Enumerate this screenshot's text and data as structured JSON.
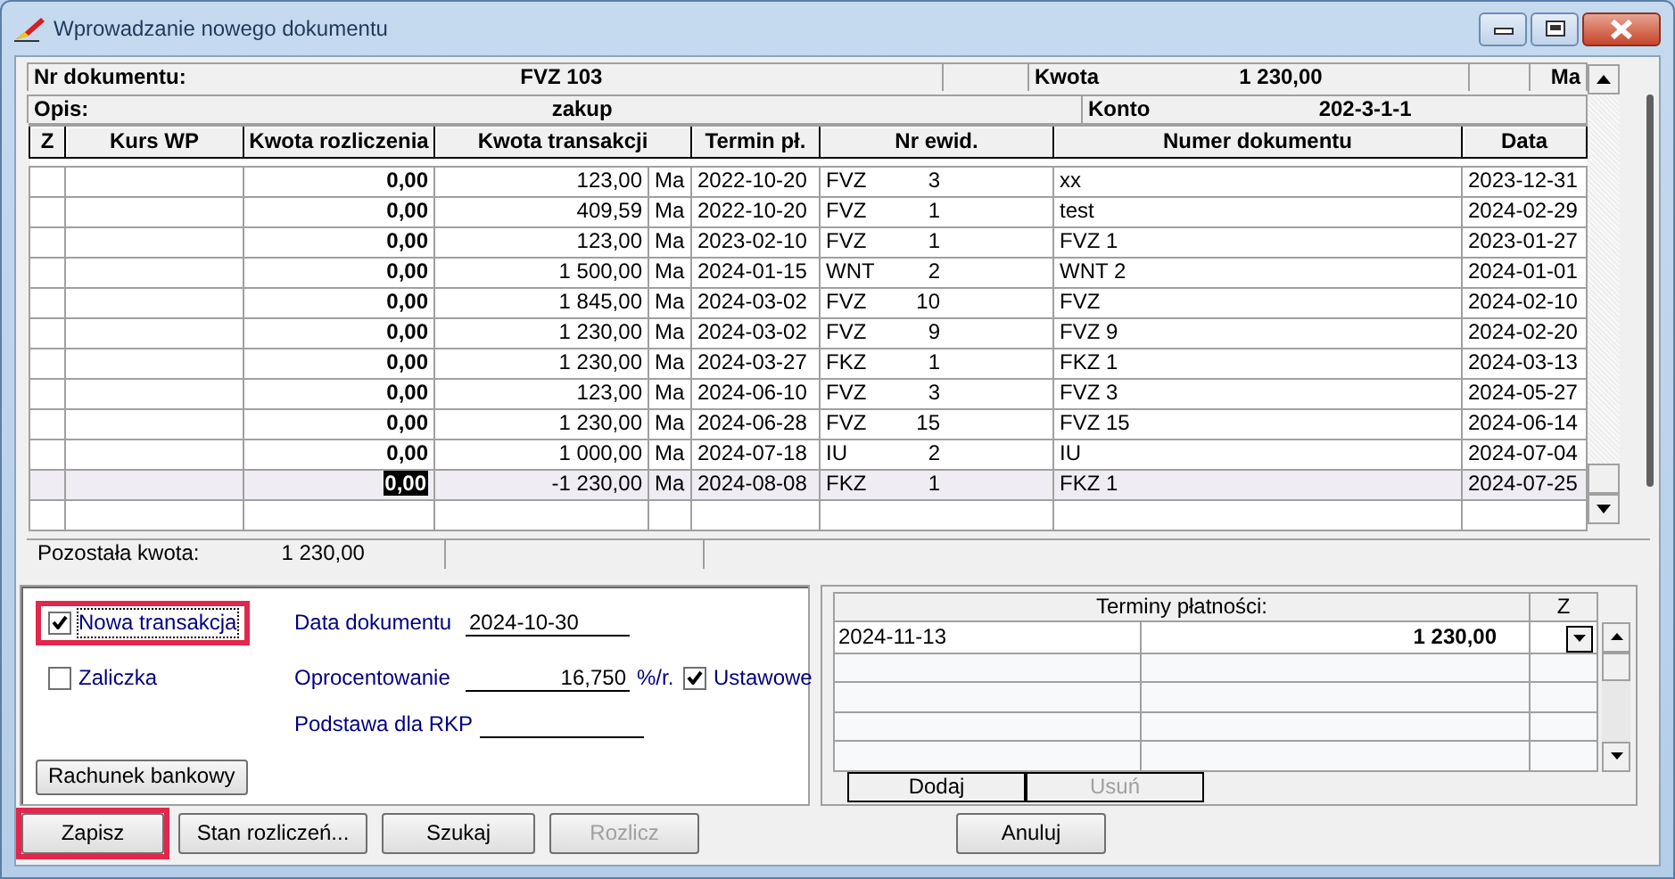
{
  "window": {
    "title": "Wprowadzanie nowego dokumentu"
  },
  "document_header": {
    "nr_label": "Nr dokumentu:",
    "nr_value": "FVZ 103",
    "kwota_label": "Kwota",
    "kwota_value": "1 230,00",
    "currency": "Ma",
    "opis_label": "Opis:",
    "opis_value": "zakup",
    "konto_label": "Konto",
    "konto_value": "202-3-1-1"
  },
  "table": {
    "columns": [
      "Z",
      "Kurs WP",
      "Kwota rozliczenia",
      "Kwota transakcji",
      "Termin pł.",
      "Nr ewid.",
      "Numer dokumentu",
      "Data"
    ],
    "rows": [
      {
        "kwota_rozliczenia": "0,00",
        "kwota_transakcji": "123,00",
        "side": "Ma",
        "termin": "2022-10-20",
        "nr_ewid_type": "FVZ",
        "nr_ewid_number": "3",
        "numer_dokumentu": "xx",
        "data": "2023-12-31",
        "selected": false
      },
      {
        "kwota_rozliczenia": "0,00",
        "kwota_transakcji": "409,59",
        "side": "Ma",
        "termin": "2022-10-20",
        "nr_ewid_type": "FVZ",
        "nr_ewid_number": "1",
        "numer_dokumentu": "test",
        "data": "2024-02-29",
        "selected": false
      },
      {
        "kwota_rozliczenia": "0,00",
        "kwota_transakcji": "123,00",
        "side": "Ma",
        "termin": "2023-02-10",
        "nr_ewid_type": "FVZ",
        "nr_ewid_number": "1",
        "numer_dokumentu": "FVZ 1",
        "data": "2023-01-27",
        "selected": false
      },
      {
        "kwota_rozliczenia": "0,00",
        "kwota_transakcji": "1 500,00",
        "side": "Ma",
        "termin": "2024-01-15",
        "nr_ewid_type": "WNT",
        "nr_ewid_number": "2",
        "numer_dokumentu": "WNT 2",
        "data": "2024-01-01",
        "selected": false
      },
      {
        "kwota_rozliczenia": "0,00",
        "kwota_transakcji": "1 845,00",
        "side": "Ma",
        "termin": "2024-03-02",
        "nr_ewid_type": "FVZ",
        "nr_ewid_number": "10",
        "numer_dokumentu": "FVZ",
        "data": "2024-02-10",
        "selected": false
      },
      {
        "kwota_rozliczenia": "0,00",
        "kwota_transakcji": "1 230,00",
        "side": "Ma",
        "termin": "2024-03-02",
        "nr_ewid_type": "FVZ",
        "nr_ewid_number": "9",
        "numer_dokumentu": "FVZ 9",
        "data": "2024-02-20",
        "selected": false
      },
      {
        "kwota_rozliczenia": "0,00",
        "kwota_transakcji": "1 230,00",
        "side": "Ma",
        "termin": "2024-03-27",
        "nr_ewid_type": "FKZ",
        "nr_ewid_number": "1",
        "numer_dokumentu": "FKZ 1",
        "data": "2024-03-13",
        "selected": false
      },
      {
        "kwota_rozliczenia": "0,00",
        "kwota_transakcji": "123,00",
        "side": "Ma",
        "termin": "2024-06-10",
        "nr_ewid_type": "FVZ",
        "nr_ewid_number": "3",
        "numer_dokumentu": "FVZ 3",
        "data": "2024-05-27",
        "selected": false
      },
      {
        "kwota_rozliczenia": "0,00",
        "kwota_transakcji": "1 230,00",
        "side": "Ma",
        "termin": "2024-06-28",
        "nr_ewid_type": "FVZ",
        "nr_ewid_number": "15",
        "numer_dokumentu": "FVZ 15",
        "data": "2024-06-14",
        "selected": false
      },
      {
        "kwota_rozliczenia": "0,00",
        "kwota_transakcji": "1 000,00",
        "side": "Ma",
        "termin": "2024-07-18",
        "nr_ewid_type": "IU",
        "nr_ewid_number": "2",
        "numer_dokumentu": "IU",
        "data": "2024-07-04",
        "selected": false
      },
      {
        "kwota_rozliczenia": "0,00",
        "kwota_transakcji": "-1 230,00",
        "side": "Ma",
        "termin": "2024-08-08",
        "nr_ewid_type": "FKZ",
        "nr_ewid_number": "1",
        "numer_dokumentu": "FKZ 1",
        "data": "2024-07-25",
        "selected": true
      }
    ]
  },
  "summary": {
    "label": "Pozostała kwota:",
    "value": "1 230,00"
  },
  "options": {
    "checkboxes": [
      {
        "label": "Nowa transakcja",
        "checked": true,
        "highlighted": true
      },
      {
        "label": "Zaliczka",
        "checked": false,
        "highlighted": false
      }
    ],
    "fields": [
      {
        "label": "Data dokumentu",
        "value": "2024-10-30"
      },
      {
        "label": "Oprocentowanie",
        "value": "16,750",
        "unit": "%/r."
      },
      {
        "label": "Podstawa dla RKP"
      }
    ],
    "ustawowe": {
      "label": "Ustawowe",
      "checked": true
    },
    "bank_button": "Rachunek bankowy"
  },
  "payment_terms": {
    "columns": [
      "Terminy płatności:",
      "Z"
    ],
    "rows": [
      {
        "date": "2024-11-13",
        "amount": "1 230,00"
      }
    ],
    "buttons": [
      {
        "label": "Dodaj",
        "disabled": false
      },
      {
        "label": "Usuń",
        "disabled": true
      }
    ]
  },
  "buttons": [
    {
      "label": "Zapisz",
      "disabled": false,
      "highlighted": true
    },
    {
      "label": "Stan rozliczeń...",
      "disabled": false,
      "highlighted": false
    },
    {
      "label": "Szukaj",
      "disabled": false,
      "highlighted": false
    },
    {
      "label": "Rozlicz",
      "disabled": true,
      "highlighted": false
    },
    {
      "label": "Anuluj",
      "disabled": false,
      "highlighted": false
    }
  ]
}
